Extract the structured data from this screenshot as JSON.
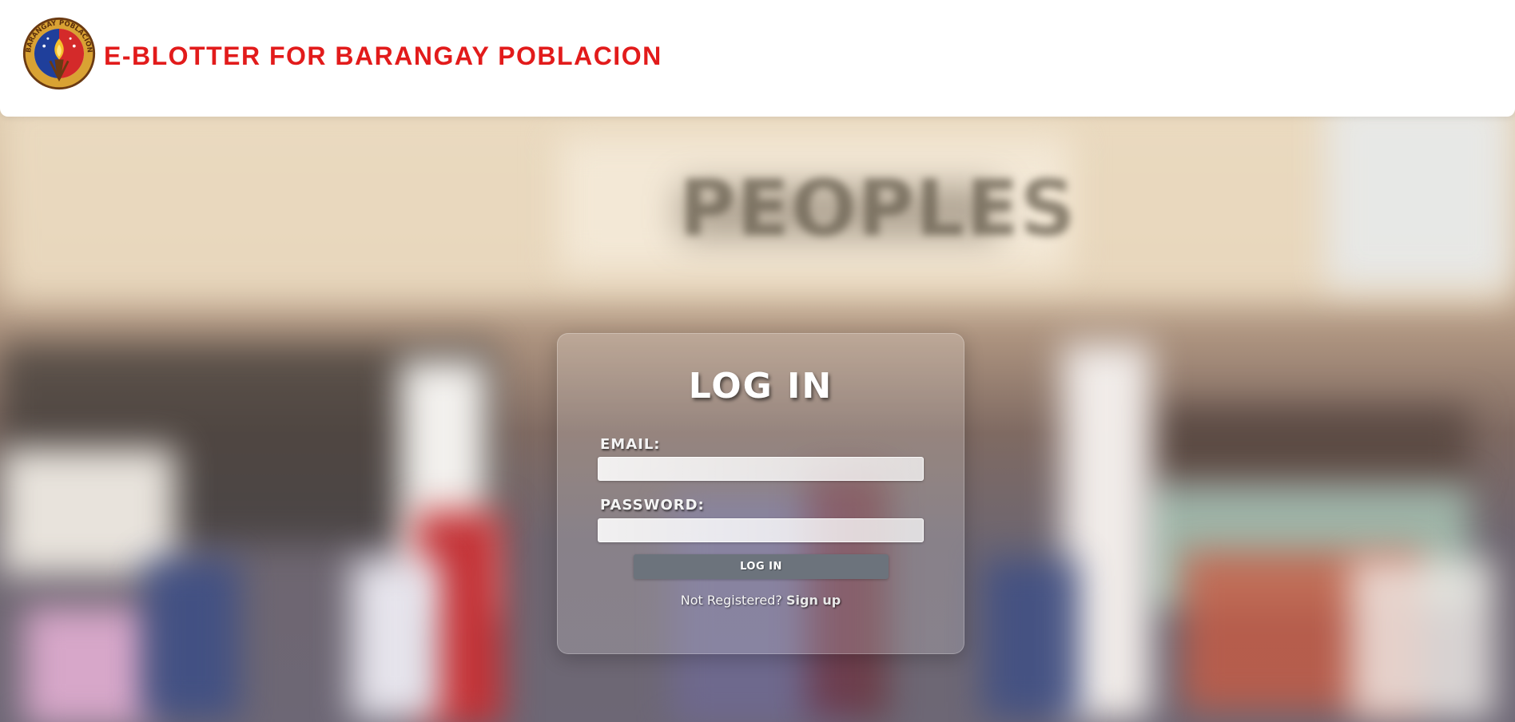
{
  "header": {
    "title": "E-BLOTTER FOR BARANGAY POBLACION",
    "logo_text": "BARANGAY POBLACION"
  },
  "background": {
    "sign_text": "PEOPLES"
  },
  "login": {
    "title": "LOG IN",
    "email_label": "EMAIL:",
    "email_value": "",
    "password_label": "PASSWORD:",
    "password_value": "",
    "submit_label": "LOG IN",
    "register_prompt": "Not Registered?",
    "signup_label": "Sign up"
  },
  "colors": {
    "title_red": "#e21b1b",
    "button_gray": "#6c737c"
  }
}
